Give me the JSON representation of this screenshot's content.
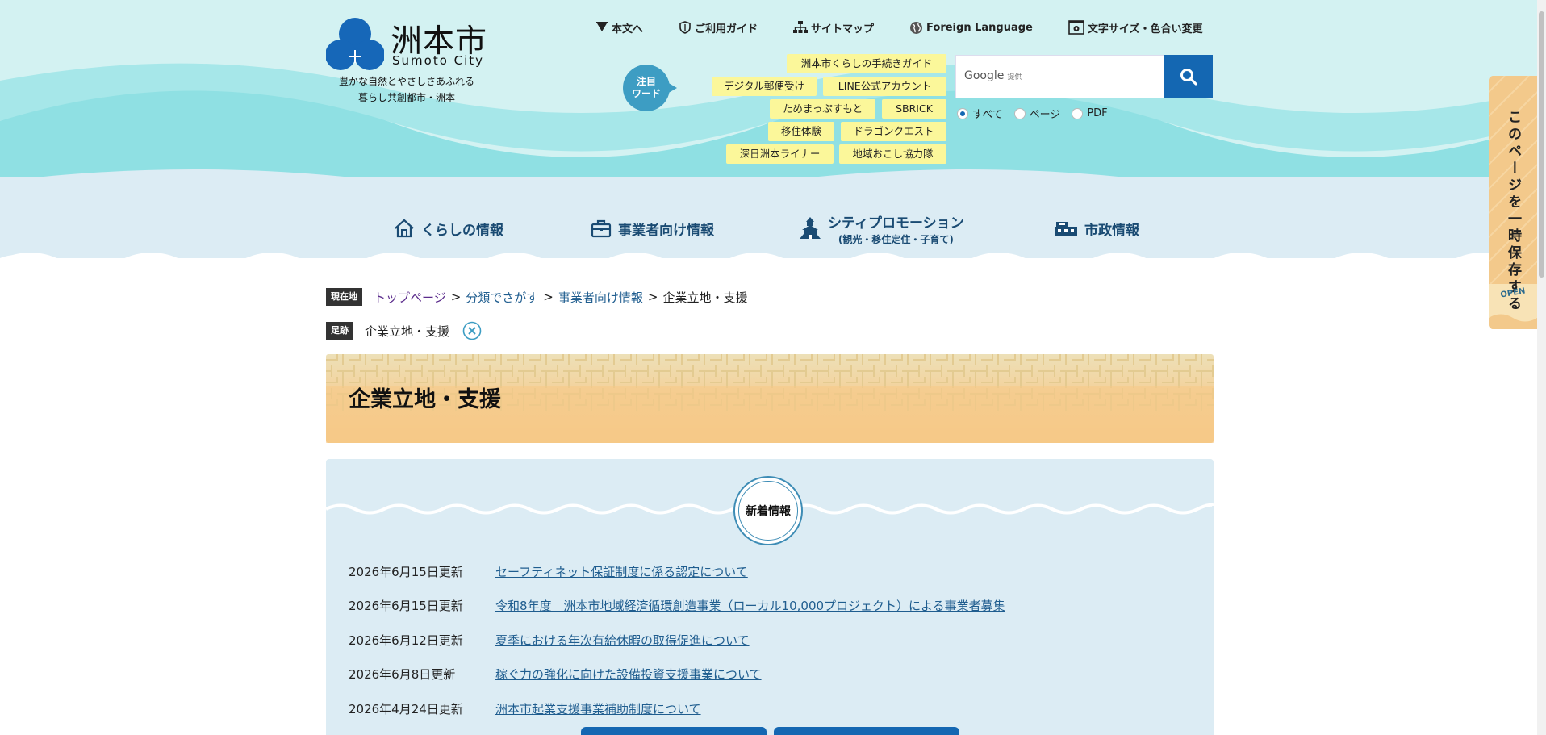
{
  "site": {
    "title": "洲本市",
    "subtitle": "Sumoto City",
    "catch_line1": "豊かな自然とやさしさあふれる",
    "catch_line2": "暮らし共創都市・洲本"
  },
  "utility_nav": [
    {
      "label": "本文へ",
      "icon": "arrow-down-icon"
    },
    {
      "label": "ご利用ガイド",
      "icon": "guide-icon"
    },
    {
      "label": "サイトマップ",
      "icon": "sitemap-icon"
    },
    {
      "label": "Foreign Language",
      "icon": "globe-icon"
    },
    {
      "label": "文字サイズ・色合い変更",
      "icon": "display-settings-icon"
    }
  ],
  "attention": {
    "label_line1": "注目",
    "label_line2": "ワード"
  },
  "attention_tags": [
    "洲本市くらしの手続きガイド",
    "デジタル郵便受け",
    "LINE公式アカウント",
    "ためまっぷすもと",
    "SBRICK",
    "移住体験",
    "ドラゴンクエスト",
    "深日洲本ライナー",
    "地域おこし協力隊"
  ],
  "search": {
    "brand": "Google",
    "brand_suffix": "提供",
    "value": "",
    "button_icon": "search-icon",
    "scopes": [
      {
        "label": "すべて",
        "selected": true
      },
      {
        "label": "ページ",
        "selected": false
      },
      {
        "label": "PDF",
        "selected": false
      }
    ]
  },
  "main_nav": [
    {
      "label": "くらしの情報",
      "sub": "",
      "icon": "house-icon"
    },
    {
      "label": "事業者向け情報",
      "sub": "",
      "icon": "briefcase-icon"
    },
    {
      "label": "シティプロモーション",
      "sub": "(観光・移住定住・子育て)",
      "icon": "castle-icon"
    },
    {
      "label": "市政情報",
      "sub": "",
      "icon": "city-hall-icon"
    }
  ],
  "side_tab": {
    "label": "このページを一時保存する",
    "open_label": "OPEN"
  },
  "breadcrumb": {
    "badge": "現在地",
    "items": [
      "トップページ",
      "分類でさがす",
      "事業者向け情報"
    ],
    "separator": ">",
    "current": "企業立地・支援"
  },
  "footprint": {
    "badge": "足跡",
    "item": "企業立地・支援"
  },
  "page": {
    "title": "企業立地・支援"
  },
  "news": {
    "heading": "新着情報",
    "items": [
      {
        "date": "2026年6月15日更新",
        "title": "セーフティネット保証制度に係る認定について"
      },
      {
        "date": "2026年6月15日更新",
        "title": "令和8年度　洲本市地域経済循環創造事業（ローカル10,000プロジェクト）による事業者募集"
      },
      {
        "date": "2026年6月12日更新",
        "title": "夏季における年次有給休暇の取得促進について"
      },
      {
        "date": "2026年6月8日更新",
        "title": "稼ぐ力の強化に向けた設備投資支援事業について"
      },
      {
        "date": "2026年4月24日更新",
        "title": "洲本市起業支援事業補助制度について"
      }
    ]
  },
  "colors": {
    "header_top": "#d3f2f2",
    "wave": "#8fe0e3",
    "nav_band": "#dcecf4",
    "accent_blue": "#1467b2",
    "tag_yellow": "#fbf79a",
    "banner_orange": "#f5c987",
    "side_tab": "#f3c98b"
  }
}
